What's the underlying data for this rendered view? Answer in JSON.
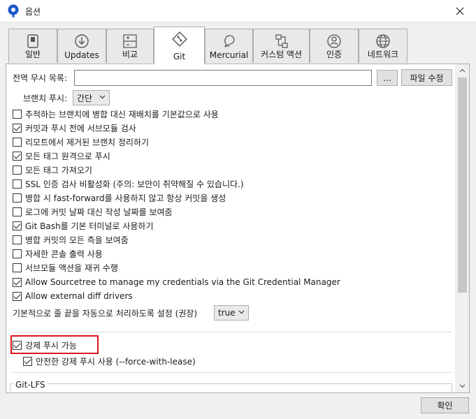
{
  "window": {
    "title": "옵션"
  },
  "tabs": [
    {
      "label": "일반",
      "icon": "switch-icon",
      "active": false
    },
    {
      "label": "Updates",
      "icon": "download-icon",
      "active": false
    },
    {
      "label": "비교",
      "icon": "diff-icon",
      "active": false
    },
    {
      "label": "Git",
      "icon": "git-icon",
      "active": true
    },
    {
      "label": "Mercurial",
      "icon": "mercurial-icon",
      "active": false
    },
    {
      "label": "커스텀 액션",
      "icon": "custom-action-icon",
      "active": false
    },
    {
      "label": "인증",
      "icon": "user-icon",
      "active": false
    },
    {
      "label": "네트워크",
      "icon": "globe-icon",
      "active": false
    }
  ],
  "git": {
    "global_ignore_label": "전역 무시 목록:",
    "global_ignore_value": "",
    "browse_label": "...",
    "edit_file_label": "파일 수정",
    "branch_push_label": "브랜치 푸시:",
    "branch_push_value": "간단",
    "options": [
      {
        "label": "추적하는 브랜치에 병합 대신 재배치를 기본값으로 사용",
        "checked": false
      },
      {
        "label": "커밋과 푸시 전에 서브모듈 검사",
        "checked": true
      },
      {
        "label": "리모트에서 제거된 브랜치 정리하기",
        "checked": false
      },
      {
        "label": "모든 태그 원격으로 푸시",
        "checked": true
      },
      {
        "label": "모든 태그 가져오기",
        "checked": false
      },
      {
        "label": "SSL 인증 검사 비활성화 (주의: 보안이 취약해질 수 있습니다.)",
        "checked": false
      },
      {
        "label": "병합 시 fast-forward를 사용하지 않고 항상 커밋을 생성",
        "checked": false
      },
      {
        "label": "로그에 커밋 날짜 대신 작성 날짜를 보여줌",
        "checked": false
      },
      {
        "label": "Git Bash를 기본 터미널로 사용하기",
        "checked": true
      },
      {
        "label": "병합 커밋의 모든 측을 보여줌",
        "checked": false
      },
      {
        "label": "자세한 콘솔 출력 사용",
        "checked": false
      },
      {
        "label": "서브모듈 액션을 재귀 수행",
        "checked": false
      },
      {
        "label": "Allow Sourcetree to manage my credentials via the Git Credential Manager",
        "checked": true
      },
      {
        "label": "Allow external diff drivers",
        "checked": true
      }
    ],
    "line_ending_label": "기본적으로 줄 끝을 자동으로 처리하도록 설정 (권장)",
    "line_ending_value": "true",
    "force_push": {
      "label": "강제 푸시 가능",
      "checked": true
    },
    "force_with_lease": {
      "label": "안전한 강제 푸시 사용 (--force-with-lease)",
      "checked": true
    },
    "git_lfs_label": "Git-LFS"
  },
  "footer": {
    "ok_label": "확인"
  },
  "colors": {
    "highlight": "#e0141e"
  }
}
